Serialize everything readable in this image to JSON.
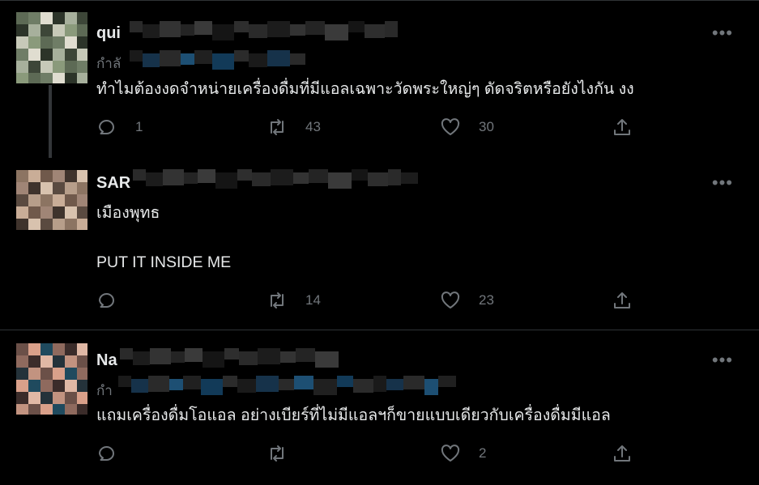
{
  "tweets": [
    {
      "name": "qui",
      "handle": "กำลั",
      "text_lines": [
        "ทำไมต้องงดจำหน่ายเครื่องดื่มที่มีแอลเฉพาะวัดพระใหญ่ๆ ดัดจริตหรือยังไงกัน งง"
      ],
      "reply_count": "1",
      "retweet_count": "43",
      "like_count": "30"
    },
    {
      "name": "SAR",
      "handle": "",
      "text_lines": [
        "เมืองพุทธ",
        "PUT IT INSIDE ME"
      ],
      "reply_count": "",
      "retweet_count": "14",
      "like_count": "23"
    },
    {
      "name": "Na",
      "handle": "กำ",
      "text_lines": [
        "แถมเครื่องดื่มโอแอล อย่างเบียร์ที่ไม่มีแอลฯก็ขายแบบเดียวกับเครื่องดื่มมีแอล"
      ],
      "reply_count": "",
      "retweet_count": "",
      "like_count": "2"
    }
  ],
  "icons": {
    "more": "more-horizontal-icon",
    "reply": "reply-bubble-icon",
    "retweet": "retweet-arrows-icon",
    "like": "heart-icon",
    "share": "share-upload-icon"
  },
  "colors": {
    "background": "#000000",
    "text": "#e7e9ea",
    "muted": "#71767b",
    "divider": "#2f3336",
    "link_blur": "#1d4f73"
  },
  "more_glyph": "•••"
}
